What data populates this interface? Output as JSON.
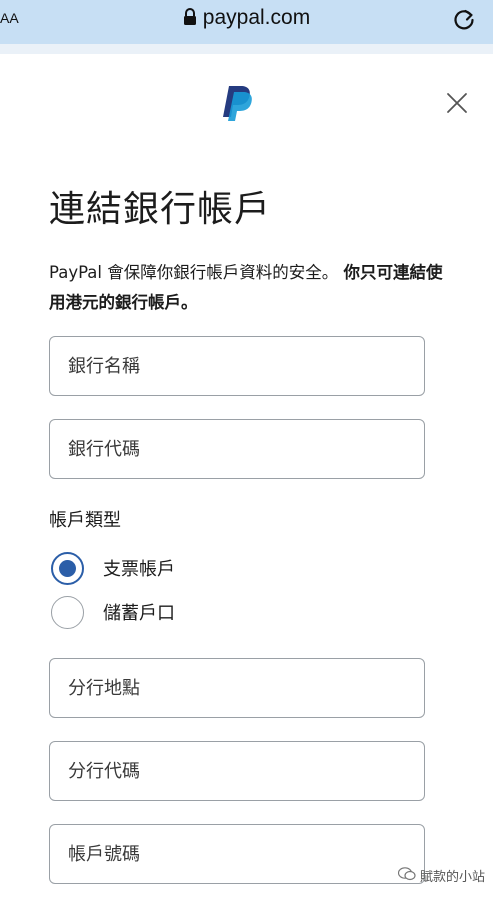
{
  "browser": {
    "text_size_label": "AA",
    "url": "paypal.com"
  },
  "page": {
    "title": "連結銀行帳戶",
    "description_normal": "PayPal 會保障你銀行帳戶資料的安全。 ",
    "description_bold": "你只可連結使用港元的銀行帳戶。"
  },
  "form": {
    "bank_name_placeholder": "銀行名稱",
    "bank_code_placeholder": "銀行代碼",
    "account_type_label": "帳戶類型",
    "account_types": [
      {
        "label": "支票帳戶",
        "checked": true
      },
      {
        "label": "儲蓄戶口",
        "checked": false
      }
    ],
    "branch_location_placeholder": "分行地點",
    "branch_code_placeholder": "分行代碼",
    "account_number_placeholder": "帳戶號碼"
  },
  "watermark": {
    "text": "賦款的小站"
  },
  "colors": {
    "url_bar": "#c7dff4",
    "radio_accent": "#2b5ea8",
    "paypal_dark": "#253b80",
    "paypal_light": "#179bd7"
  }
}
